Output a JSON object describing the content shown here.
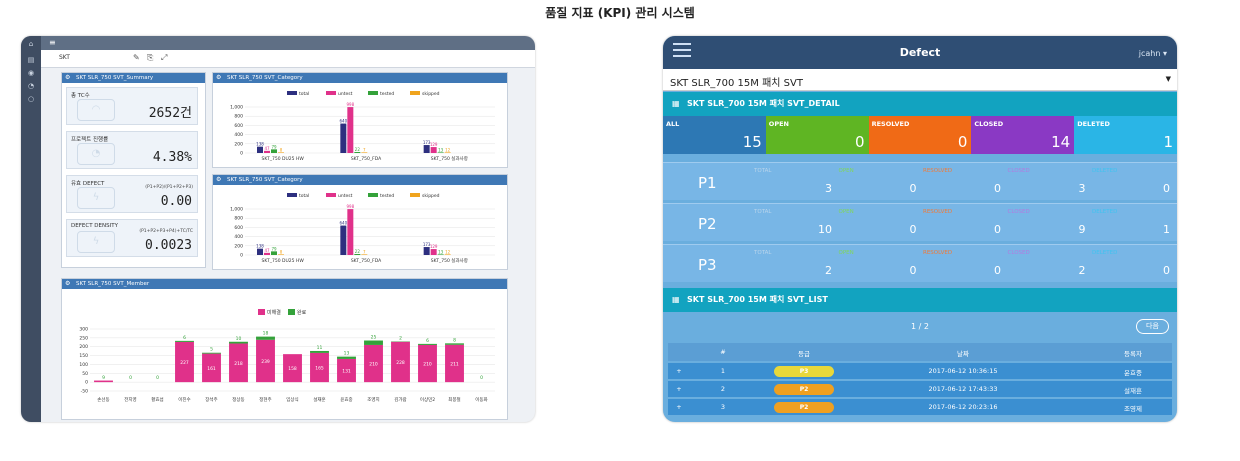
{
  "page_title": "품질 지표 (KPI) 관리 시스템",
  "dashboard": {
    "project": "SKT",
    "summary": {
      "title": "SKT SLR_750 SVT_Summary",
      "cards": [
        {
          "label": "총 TC수",
          "formula": "",
          "value": "2652건"
        },
        {
          "label": "프로젝트 진행률",
          "formula": "",
          "value": "4.38%"
        },
        {
          "label": "유효 DEFECT",
          "formula": "(P1+P2)/(P1+P2+P3)",
          "value": "0.00"
        },
        {
          "label": "DEFECT DENSITY",
          "formula": "(P1+P2+P3+P4)+TC/TC",
          "value": "0.0023"
        }
      ]
    },
    "category_charts": [
      {
        "title": "SKT SLR_750 SVT_Category"
      },
      {
        "title": "SKT SLR_750 SVT_Category"
      }
    ],
    "member_chart": {
      "title": "SKT SLR_750 SVT_Member"
    }
  },
  "chart_data": [
    {
      "type": "bar",
      "title": "SKT SLR_750 SVT_Category",
      "categories": [
        "SKT_750 DU25 HW",
        "SKT_750_FDA",
        "SKT_750 실과사항"
      ],
      "series": [
        {
          "name": "total",
          "values": [
            138,
            640,
            173
          ]
        },
        {
          "name": "untest",
          "values": [
            47,
            998,
            129
          ]
        },
        {
          "name": "tested",
          "values": [
            79,
            22,
            13
          ]
        },
        {
          "name": "skipped",
          "values": [
            8,
            7,
            12
          ]
        }
      ],
      "yticks": [
        "0",
        "200",
        "400",
        "600",
        "800",
        "1,000"
      ],
      "ylim": [
        0,
        1000
      ]
    },
    {
      "type": "bar",
      "title": "SKT SLR_750 SVT_Category",
      "categories": [
        "SKT_750 DU25 HW",
        "SKT_750_FDA",
        "SKT_750 실과사항"
      ],
      "series": [
        {
          "name": "total",
          "values": [
            138,
            640,
            173
          ]
        },
        {
          "name": "untest",
          "values": [
            47,
            998,
            129
          ]
        },
        {
          "name": "tested",
          "values": [
            79,
            22,
            13
          ]
        },
        {
          "name": "skipped",
          "values": [
            8,
            7,
            12
          ]
        }
      ],
      "yticks": [
        "0",
        "200",
        "400",
        "600",
        "800",
        "1,000"
      ],
      "ylim": [
        0,
        1000
      ]
    },
    {
      "type": "bar",
      "title": "SKT SLR_750 SVT_Member",
      "categories": [
        "손선동",
        "전지영",
        "황효섭",
        "이진수",
        "장석주",
        "정상동",
        "정현주",
        "임상식",
        "설재훈",
        "윤효중",
        "조영지",
        "김가람",
        "이상민2",
        "최봉철",
        "이동화"
      ],
      "series": [
        {
          "name": "미해결",
          "values": [
            9,
            0,
            0,
            227,
            161,
            218,
            239,
            158,
            165,
            131,
            210,
            228,
            210,
            211,
            0
          ]
        },
        {
          "name": "완료",
          "values": [
            0,
            0,
            0,
            6,
            5,
            10,
            18,
            0,
            11,
            13,
            25,
            2,
            6,
            8,
            0
          ]
        }
      ],
      "yticks": [
        "-50",
        "0",
        "50",
        "100",
        "150",
        "200",
        "250",
        "300"
      ],
      "ylim": [
        -50,
        300
      ]
    }
  ],
  "mobile": {
    "title": "Defect",
    "user": "jcahn",
    "project_select": "SKT SLR_700 15M 패치 SVT",
    "detail_title": "SKT SLR_700 15M 패치 SVT_DETAIL",
    "stats": [
      {
        "label": "ALL",
        "value": "15",
        "color": "#2d78b4"
      },
      {
        "label": "OPEN",
        "value": "0",
        "color": "#5fb523"
      },
      {
        "label": "RESOLVED",
        "value": "0",
        "color": "#f06a16"
      },
      {
        "label": "CLOSED",
        "value": "14",
        "color": "#8a39c4"
      },
      {
        "label": "DELETED",
        "value": "1",
        "color": "#2ab5e6"
      }
    ],
    "priority_rows": [
      {
        "name": "P1",
        "cells": [
          {
            "label": "TOTAL",
            "value": "3"
          },
          {
            "label": "OPEN",
            "value": "0"
          },
          {
            "label": "RESOLVED",
            "value": "0"
          },
          {
            "label": "CLOSED",
            "value": "3"
          },
          {
            "label": "DELETED",
            "value": "0"
          }
        ]
      },
      {
        "name": "P2",
        "cells": [
          {
            "label": "TOTAL",
            "value": "10"
          },
          {
            "label": "OPEN",
            "value": "0"
          },
          {
            "label": "RESOLVED",
            "value": "0"
          },
          {
            "label": "CLOSED",
            "value": "9"
          },
          {
            "label": "DELETED",
            "value": "1"
          }
        ]
      },
      {
        "name": "P3",
        "cells": [
          {
            "label": "TOTAL",
            "value": "2"
          },
          {
            "label": "OPEN",
            "value": "0"
          },
          {
            "label": "RESOLVED",
            "value": "0"
          },
          {
            "label": "CLOSED",
            "value": "2"
          },
          {
            "label": "DELETED",
            "value": "0"
          }
        ]
      }
    ],
    "cell_label_colors": [
      "#b8d4ec",
      "#7fd65a",
      "#f07a38",
      "#b27be0",
      "#3fc3f0"
    ],
    "list_title": "SKT SLR_700 15M 패치 SVT_LIST",
    "pager_text": "1 / 2",
    "next_button": "다음",
    "table_headers": [
      "#",
      "등급",
      "날짜",
      "등록자"
    ],
    "table_rows": [
      {
        "expand": "+",
        "no": "1",
        "grade": "P3",
        "grade_color": "#e8d83a",
        "date": "2017-06-12 10:36:15",
        "author": "윤효중"
      },
      {
        "expand": "+",
        "no": "2",
        "grade": "P2",
        "grade_color": "#f0a020",
        "date": "2017-06-12 17:43:33",
        "author": "설재훈"
      },
      {
        "expand": "+",
        "no": "3",
        "grade": "P2",
        "grade_color": "#f0a020",
        "date": "2017-06-12 20:23:16",
        "author": "조영제"
      }
    ]
  }
}
